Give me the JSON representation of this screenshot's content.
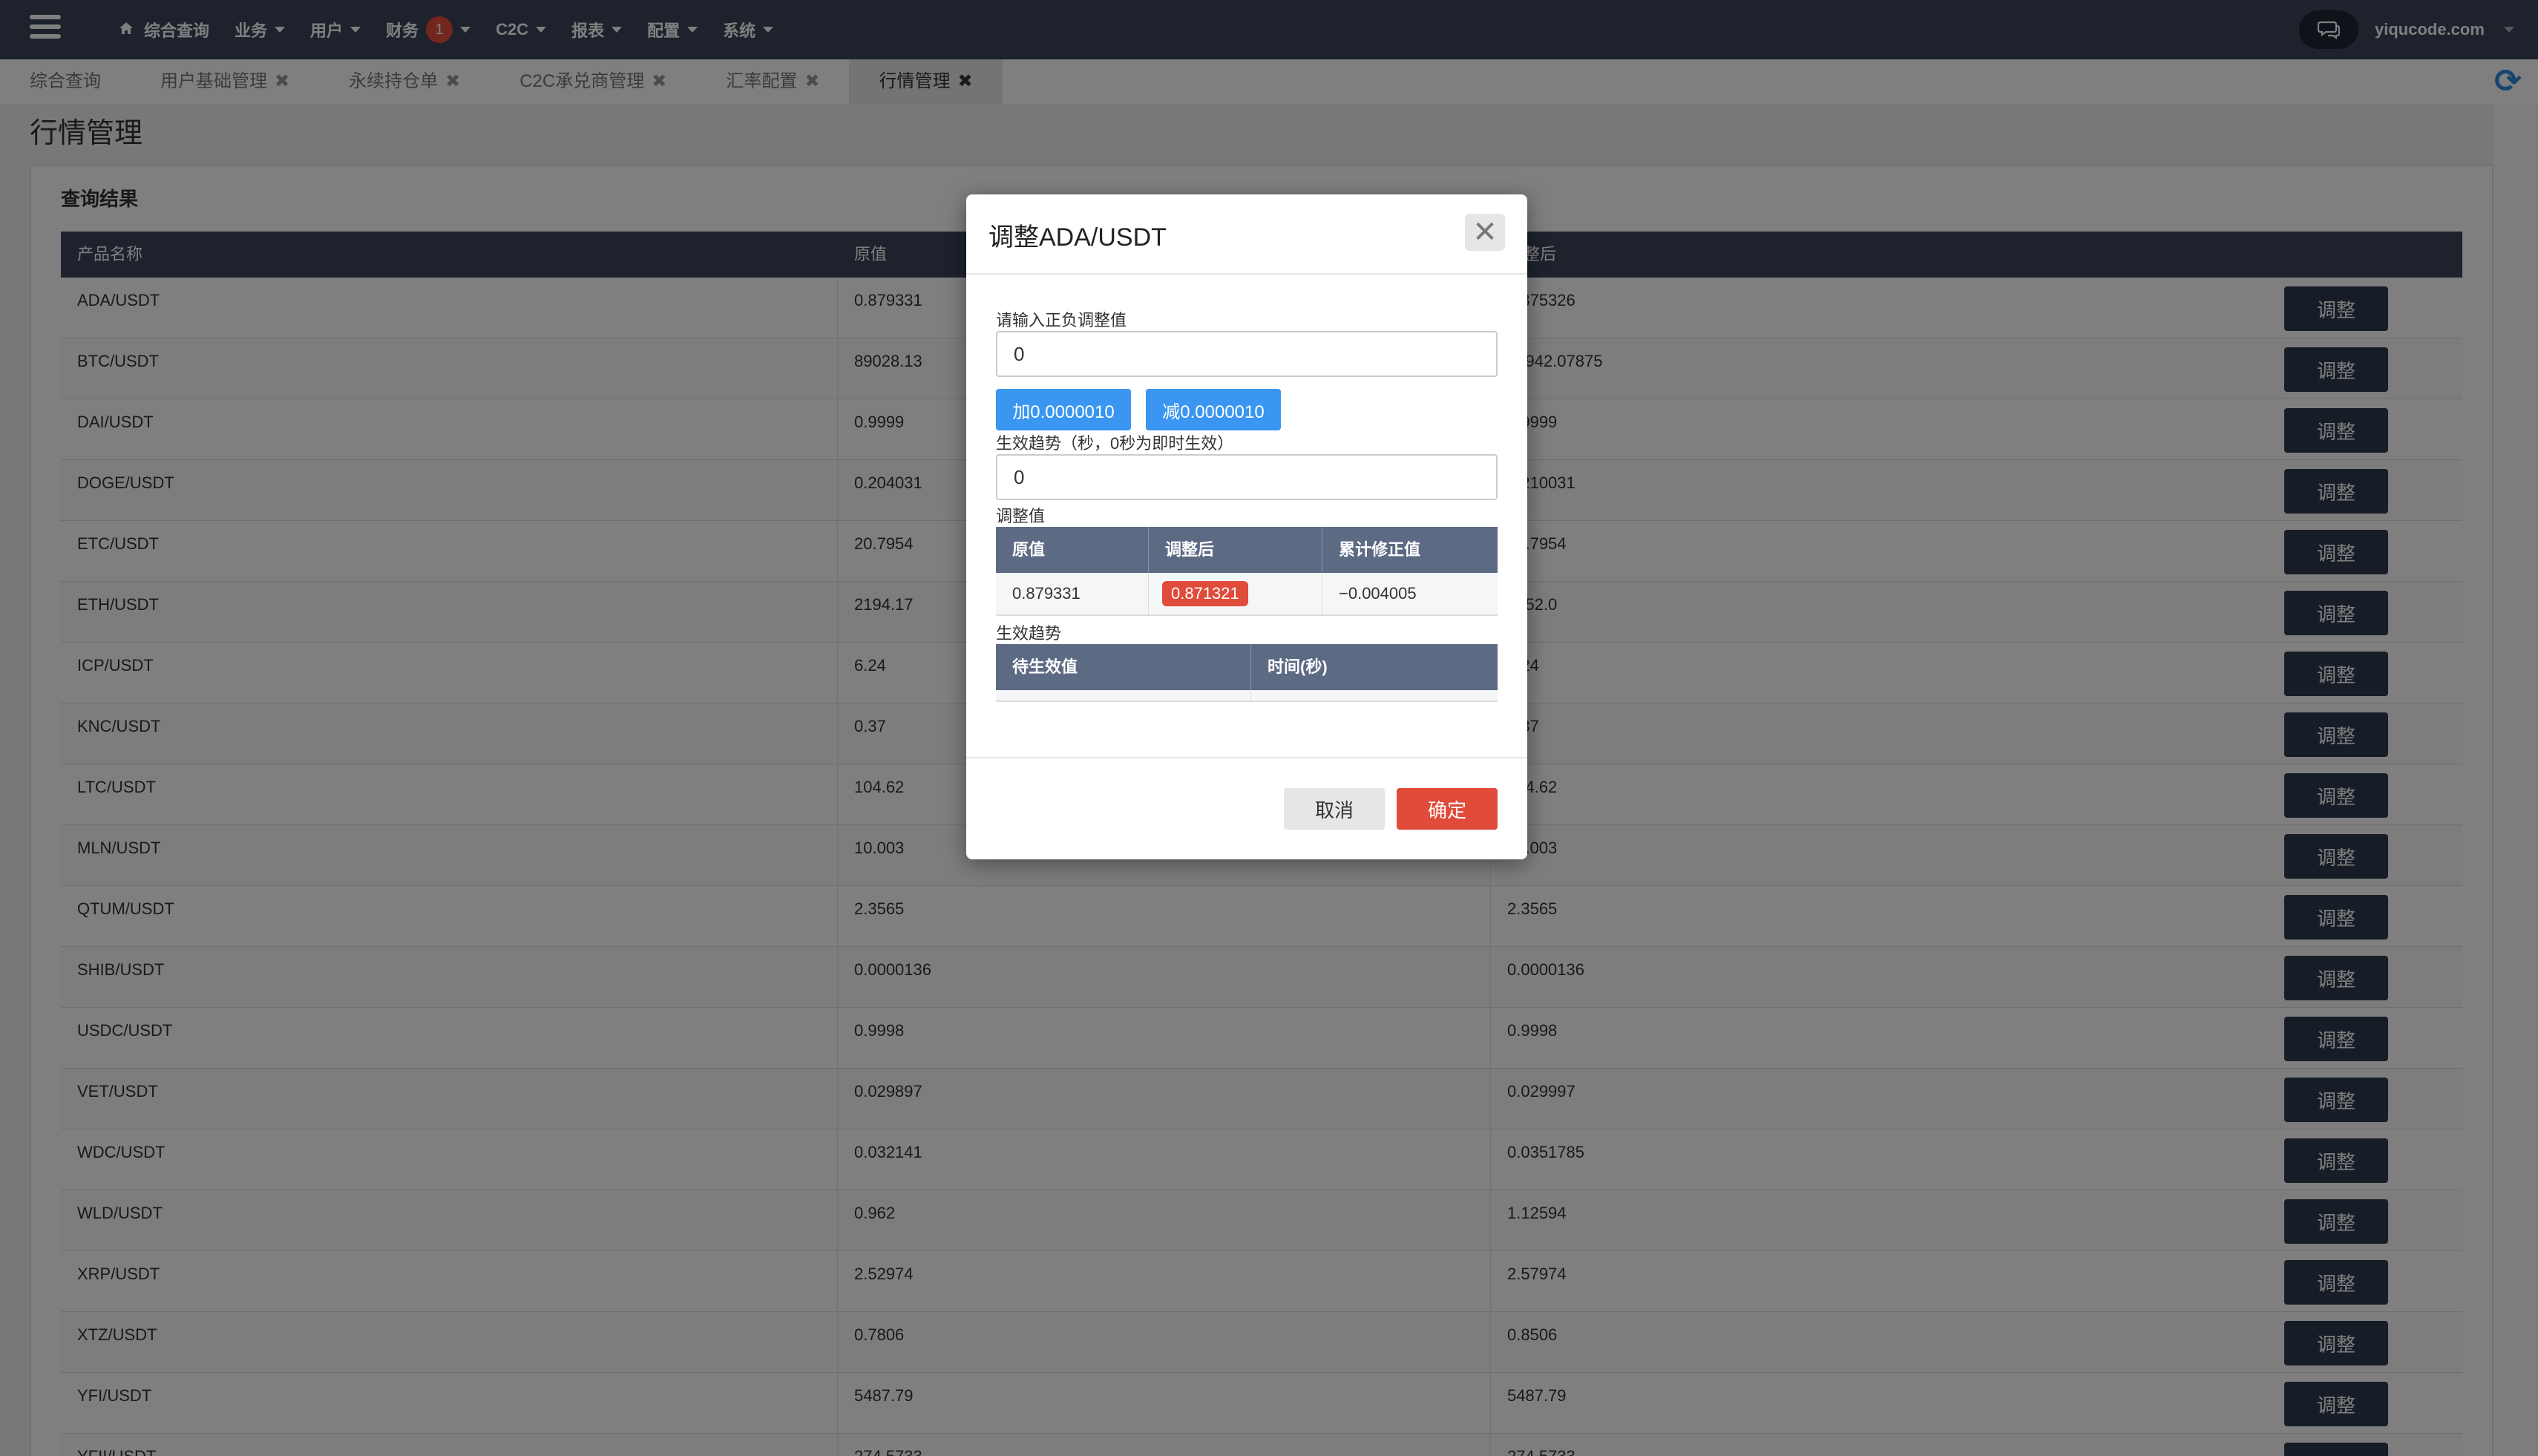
{
  "navbar": {
    "menu": [
      {
        "label": "综合查询",
        "has_caret": false,
        "home": true
      },
      {
        "label": "业务",
        "has_caret": true
      },
      {
        "label": "用户",
        "has_caret": true
      },
      {
        "label": "财务",
        "has_caret": true,
        "badge": "1"
      },
      {
        "label": "C2C",
        "has_caret": true
      },
      {
        "label": "报表",
        "has_caret": true
      },
      {
        "label": "配置",
        "has_caret": true
      },
      {
        "label": "系统",
        "has_caret": true
      }
    ],
    "user": "yiqucode.com"
  },
  "tabs": [
    {
      "label": "综合查询",
      "closable": false,
      "active": false
    },
    {
      "label": "用户基础管理",
      "closable": true,
      "active": false
    },
    {
      "label": "永续持仓单",
      "closable": true,
      "active": false
    },
    {
      "label": "C2C承兑商管理",
      "closable": true,
      "active": false
    },
    {
      "label": "汇率配置",
      "closable": true,
      "active": false
    },
    {
      "label": "行情管理",
      "closable": true,
      "active": true
    }
  ],
  "page": {
    "title": "行情管理",
    "panel_title": "查询结果",
    "columns": [
      "产品名称",
      "原值",
      "调整后",
      ""
    ],
    "adjust_label": "调整",
    "rows": [
      {
        "name": "ADA/USDT",
        "orig": "0.879331",
        "adjusted": "0.875326"
      },
      {
        "name": "BTC/USDT",
        "orig": "89028.13",
        "adjusted": "88942.07875"
      },
      {
        "name": "DAI/USDT",
        "orig": "0.9999",
        "adjusted": "0.9999"
      },
      {
        "name": "DOGE/USDT",
        "orig": "0.204031",
        "adjusted": "0.210031"
      },
      {
        "name": "ETC/USDT",
        "orig": "20.7954",
        "adjusted": "20.7954"
      },
      {
        "name": "ETH/USDT",
        "orig": "2194.17",
        "adjusted": "2252.0"
      },
      {
        "name": "ICP/USDT",
        "orig": "6.24",
        "adjusted": "6.24"
      },
      {
        "name": "KNC/USDT",
        "orig": "0.37",
        "adjusted": "0.37"
      },
      {
        "name": "LTC/USDT",
        "orig": "104.62",
        "adjusted": "104.62"
      },
      {
        "name": "MLN/USDT",
        "orig": "10.003",
        "adjusted": "10.003"
      },
      {
        "name": "QTUM/USDT",
        "orig": "2.3565",
        "adjusted": "2.3565"
      },
      {
        "name": "SHIB/USDT",
        "orig": "0.0000136",
        "adjusted": "0.0000136"
      },
      {
        "name": "USDC/USDT",
        "orig": "0.9998",
        "adjusted": "0.9998"
      },
      {
        "name": "VET/USDT",
        "orig": "0.029897",
        "adjusted": "0.029997"
      },
      {
        "name": "WDC/USDT",
        "orig": "0.032141",
        "adjusted": "0.0351785"
      },
      {
        "name": "WLD/USDT",
        "orig": "0.962",
        "adjusted": "1.12594"
      },
      {
        "name": "XRP/USDT",
        "orig": "2.52974",
        "adjusted": "2.57974"
      },
      {
        "name": "XTZ/USDT",
        "orig": "0.7806",
        "adjusted": "0.8506"
      },
      {
        "name": "YFI/USDT",
        "orig": "5487.79",
        "adjusted": "5487.79"
      },
      {
        "name": "YFII/USDT",
        "orig": "274.5733",
        "adjusted": "274.5733"
      }
    ]
  },
  "modal": {
    "title": "调整ADA/USDT",
    "input_label": "请输入正负调整值",
    "input_value": "0",
    "plus_label": "加0.0000010",
    "minus_label": "减0.0000010",
    "trend_label": "生效趋势（秒，0秒为即时生效）",
    "trend_value": "0",
    "adjust_section": "调整值",
    "adjust_columns": [
      "原值",
      "调整后",
      "累计修正值"
    ],
    "adjust_row": {
      "orig": "0.879331",
      "adjusted": "0.871321",
      "cumulative": "−0.004005"
    },
    "effect_section": "生效趋势",
    "effect_columns": [
      "待生效值",
      "时间(秒)"
    ],
    "cancel_label": "取消",
    "ok_label": "确定"
  }
}
